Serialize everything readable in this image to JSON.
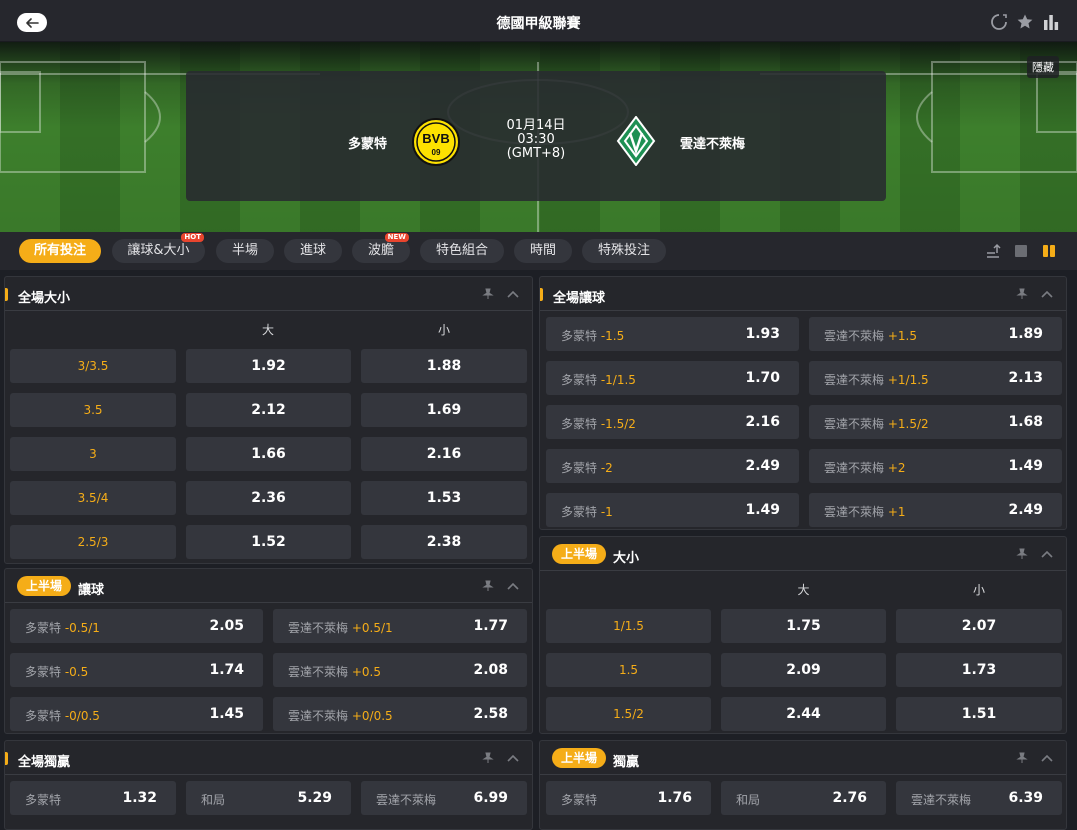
{
  "header": {
    "title": "德國甲級聯賽",
    "back_icon": "arrow-left-icon",
    "icons": [
      "refresh-icon",
      "star-icon",
      "stats-icon"
    ]
  },
  "hero": {
    "hide_label": "隱藏",
    "home_team": "多蒙特",
    "away_team": "雲達不萊梅",
    "date": "01月14日",
    "time": "03:30",
    "timezone": "(GMT+8)",
    "home_logo_text": "BVB",
    "home_logo_num": "09"
  },
  "tabs": [
    {
      "label": "所有投注",
      "active": true
    },
    {
      "label": "讓球&大小",
      "badge": "HOT"
    },
    {
      "label": "半場"
    },
    {
      "label": "進球"
    },
    {
      "label": "波膽",
      "badge": "NEW"
    },
    {
      "label": "特色組合"
    },
    {
      "label": "時間"
    },
    {
      "label": "特殊投注"
    }
  ],
  "panels": {
    "ft_ou": {
      "title": "全場大小",
      "col_over": "大",
      "col_under": "小",
      "rows": [
        {
          "line": "3/3.5",
          "over": "1.92",
          "under": "1.88"
        },
        {
          "line": "3.5",
          "over": "2.12",
          "under": "1.69"
        },
        {
          "line": "3",
          "over": "1.66",
          "under": "2.16"
        },
        {
          "line": "3.5/4",
          "over": "2.36",
          "under": "1.53"
        },
        {
          "line": "2.5/3",
          "over": "1.52",
          "under": "2.38"
        }
      ]
    },
    "ft_hdp": {
      "title": "全場讓球",
      "rows": [
        {
          "home": "多蒙特",
          "home_hc": "-1.5",
          "home_odd": "1.93",
          "away": "雲達不萊梅",
          "away_hc": "+1.5",
          "away_odd": "1.89"
        },
        {
          "home": "多蒙特",
          "home_hc": "-1/1.5",
          "home_odd": "1.70",
          "away": "雲達不萊梅",
          "away_hc": "+1/1.5",
          "away_odd": "2.13"
        },
        {
          "home": "多蒙特",
          "home_hc": "-1.5/2",
          "home_odd": "2.16",
          "away": "雲達不萊梅",
          "away_hc": "+1.5/2",
          "away_odd": "1.68"
        },
        {
          "home": "多蒙特",
          "home_hc": "-2",
          "home_odd": "2.49",
          "away": "雲達不萊梅",
          "away_hc": "+2",
          "away_odd": "1.49"
        },
        {
          "home": "多蒙特",
          "home_hc": "-1",
          "home_odd": "1.49",
          "away": "雲達不萊梅",
          "away_hc": "+1",
          "away_odd": "2.49"
        }
      ]
    },
    "h1_hdp": {
      "half": "上半場",
      "title": "讓球",
      "rows": [
        {
          "home": "多蒙特",
          "home_hc": "-0.5/1",
          "home_odd": "2.05",
          "away": "雲達不萊梅",
          "away_hc": "+0.5/1",
          "away_odd": "1.77"
        },
        {
          "home": "多蒙特",
          "home_hc": "-0.5",
          "home_odd": "1.74",
          "away": "雲達不萊梅",
          "away_hc": "+0.5",
          "away_odd": "2.08"
        },
        {
          "home": "多蒙特",
          "home_hc": "-0/0.5",
          "home_odd": "1.45",
          "away": "雲達不萊梅",
          "away_hc": "+0/0.5",
          "away_odd": "2.58"
        }
      ]
    },
    "h1_ou": {
      "half": "上半場",
      "title": "大小",
      "col_over": "大",
      "col_under": "小",
      "rows": [
        {
          "line": "1/1.5",
          "over": "1.75",
          "under": "2.07"
        },
        {
          "line": "1.5",
          "over": "2.09",
          "under": "1.73"
        },
        {
          "line": "1.5/2",
          "over": "2.44",
          "under": "1.51"
        }
      ]
    },
    "ft_1x2": {
      "title": "全場獨贏",
      "home": "多蒙特",
      "home_odd": "1.32",
      "draw": "和局",
      "draw_odd": "5.29",
      "away": "雲達不萊梅",
      "away_odd": "6.99"
    },
    "h1_1x2": {
      "half": "上半場",
      "title": "獨贏",
      "home": "多蒙特",
      "home_odd": "1.76",
      "draw": "和局",
      "draw_odd": "2.76",
      "away": "雲達不萊梅",
      "away_odd": "6.39"
    }
  },
  "colors": {
    "accent": "#f5ad18",
    "bg": "#1d1f25",
    "panel": "#25262b",
    "cell": "#34363d",
    "hot": "#e8452e"
  }
}
